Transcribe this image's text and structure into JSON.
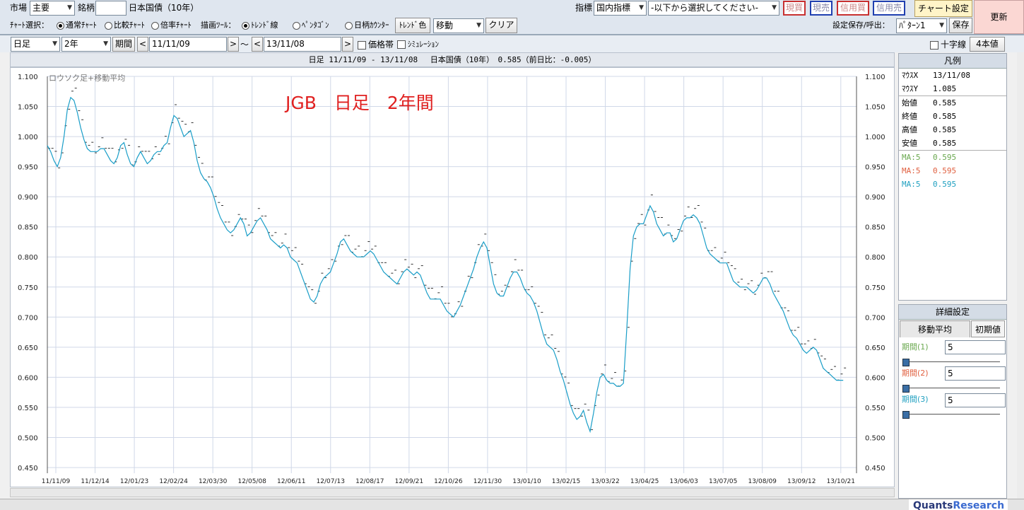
{
  "row1": {
    "market_label": "市場",
    "market_value": "主要",
    "symbol_label": "銘柄",
    "symbol_value": "",
    "symbol_name": "日本国債（10年）",
    "indicator_label": "指標",
    "indicator_value": "国内指標",
    "indicator_select": "-以下から選択してください-",
    "trade_buttons": [
      {
        "label": "現買",
        "color": "#c83030"
      },
      {
        "label": "現売",
        "color": "#2040b0"
      },
      {
        "label": "信用買",
        "color": "#c83030"
      },
      {
        "label": "信用売",
        "color": "#2040b0"
      }
    ],
    "chart_settings": "チャート設定",
    "refresh": "更新"
  },
  "row2": {
    "chart_select_label": "ﾁｬｰﾄ選択：",
    "chart_types": [
      {
        "label": "通常ﾁｬｰﾄ",
        "checked": true
      },
      {
        "label": "比較ﾁｬｰﾄ",
        "checked": false
      },
      {
        "label": "倍率ﾁｬｰﾄ",
        "checked": false
      }
    ],
    "draw_tool_label": "描画ﾂｰﾙ：",
    "draw_tools": [
      {
        "label": "ﾄﾚﾝﾄﾞ線",
        "checked": true
      },
      {
        "label": "ﾍﾟﾝﾀｺﾞﾝ",
        "checked": false
      },
      {
        "label": "日柄ｶｳﾝﾀｰ",
        "checked": false
      }
    ],
    "trend_color": "ﾄﾚﾝﾄﾞ色",
    "move_value": "移動",
    "clear": "クリア",
    "save_load_label": "設定保存/呼出：",
    "pattern_value": "ﾊﾟﾀｰﾝ1",
    "save": "保存"
  },
  "row3": {
    "period_type": "日足",
    "range": "2年",
    "period_button": "期間",
    "prev": "<",
    "next": ">",
    "from_date": "11/11/09",
    "tilde": "〜",
    "prev2": "<",
    "to_date": "13/11/08",
    "next2": ">",
    "price_band": "価格帯",
    "simulation": "ｼﾐｭﾚｰｼｮﾝ",
    "crosshair": "十字線",
    "four_values": "4本値"
  },
  "chart_header": "日足 11/11/09 - 13/11/08　 日本国債（10年）　0.585（前日比：-0.005）",
  "chart_overlay_label": "ロウソク足+移動平均",
  "annotation": "JGB　日足　2年間",
  "legend": {
    "title": "凡例",
    "mouse": [
      {
        "label": "ﾏｳｽX",
        "value": "13/11/08"
      },
      {
        "label": "ﾏｳｽY",
        "value": "1.085"
      }
    ],
    "ohlc": [
      {
        "label": "始値",
        "value": "0.585"
      },
      {
        "label": "終値",
        "value": "0.585"
      },
      {
        "label": "高値",
        "value": "0.585"
      },
      {
        "label": "安値",
        "value": "0.585"
      }
    ],
    "ma": [
      {
        "label": "MA:5",
        "value": "0.595",
        "color": "#6aa84f"
      },
      {
        "label": "MA:5",
        "value": "0.595",
        "color": "#e06040"
      },
      {
        "label": "MA:5",
        "value": "0.595",
        "color": "#20a0c0"
      }
    ]
  },
  "details": {
    "title": "詳細設定",
    "tab_ma": "移動平均",
    "tab_init": "初期値",
    "periods": [
      {
        "label": "期間(1)",
        "value": "5",
        "color": "#6aa84f"
      },
      {
        "label": "期間(2)",
        "value": "5",
        "color": "#e06040"
      },
      {
        "label": "期間(3)",
        "value": "5",
        "color": "#20a0c0"
      }
    ]
  },
  "footer_brand": [
    "Quants",
    "Research"
  ],
  "chart_data": {
    "type": "line",
    "series": [
      {
        "name": "MA:5",
        "color": "#1a9ec8"
      }
    ],
    "ylim": [
      0.45,
      1.1
    ],
    "yticks": [
      "1.100",
      "1.050",
      "1.000",
      "0.950",
      "0.900",
      "0.850",
      "0.800",
      "0.750",
      "0.700",
      "0.650",
      "0.600",
      "0.550",
      "0.500",
      "0.450"
    ],
    "xticks": [
      "11/11/09",
      "11/12/14",
      "12/01/23",
      "12/02/24",
      "12/03/30",
      "12/05/08",
      "12/06/11",
      "12/07/13",
      "12/08/17",
      "12/09/21",
      "12/10/26",
      "12/11/30",
      "13/01/10",
      "13/02/15",
      "13/03/22",
      "13/04/25",
      "13/06/03",
      "13/07/05",
      "13/08/09",
      "13/09/12",
      "13/10/21"
    ],
    "x": [
      0,
      2,
      4,
      6,
      8,
      10,
      12,
      14,
      16,
      18,
      20,
      22,
      24,
      26,
      28,
      30,
      32,
      34,
      36,
      38,
      40,
      42,
      44,
      46,
      48,
      50,
      52,
      54,
      56,
      58,
      60,
      62,
      64,
      66,
      68,
      70,
      72,
      74,
      76,
      78,
      80,
      82,
      84,
      86,
      88,
      90,
      92,
      94,
      96,
      98,
      100,
      102,
      104,
      106,
      108,
      110,
      112,
      114,
      116,
      118,
      120,
      122,
      124,
      126,
      128,
      130,
      132,
      134,
      136,
      138,
      140,
      142,
      144,
      146,
      148,
      150,
      152,
      154,
      156,
      158,
      160,
      162,
      164,
      166,
      168,
      170,
      172,
      174,
      176,
      178,
      180,
      182,
      184,
      186,
      188,
      190,
      192,
      194,
      196,
      198,
      200,
      202,
      204,
      206,
      208,
      210,
      212,
      214,
      216,
      218,
      220,
      222,
      224,
      226,
      228,
      230,
      232,
      234,
      236,
      238,
      240,
      242,
      244,
      246,
      248,
      250,
      252,
      254,
      256,
      258,
      260,
      262,
      264,
      266,
      268,
      270,
      272,
      274,
      276,
      278,
      280,
      282,
      284,
      286,
      288,
      290,
      292,
      294,
      296,
      298,
      300,
      302,
      304,
      306,
      308,
      310,
      312,
      314,
      316,
      318,
      320,
      322,
      324,
      326,
      328,
      330,
      332,
      334,
      336,
      338,
      340,
      342,
      344,
      346,
      348,
      350,
      352,
      354,
      356,
      358,
      360,
      362,
      364,
      366,
      368,
      370,
      372,
      374,
      376,
      378,
      380,
      382,
      384,
      386,
      388,
      390,
      392,
      394,
      396,
      398,
      400,
      402,
      404,
      406,
      408,
      410,
      412,
      414,
      416,
      418,
      420,
      422,
      424,
      426,
      428,
      430,
      432,
      434,
      436,
      438,
      440,
      442,
      444,
      446,
      448,
      450,
      452,
      454,
      456,
      458,
      460,
      462,
      464,
      466,
      468,
      470,
      472,
      474,
      476,
      478,
      480,
      482,
      484,
      486
    ],
    "values": [
      0.985,
      0.975,
      0.96,
      0.95,
      0.965,
      1.0,
      1.045,
      1.065,
      1.06,
      1.04,
      1.015,
      0.995,
      0.98,
      0.975,
      0.975,
      0.975,
      0.98,
      0.98,
      0.97,
      0.96,
      0.955,
      0.965,
      0.985,
      0.99,
      0.97,
      0.955,
      0.95,
      0.965,
      0.975,
      0.965,
      0.955,
      0.96,
      0.97,
      0.975,
      0.975,
      0.985,
      0.99,
      1.015,
      1.035,
      1.03,
      1.015,
      1.0,
      1.005,
      1.01,
      0.99,
      0.96,
      0.94,
      0.93,
      0.925,
      0.915,
      0.9,
      0.88,
      0.865,
      0.855,
      0.845,
      0.84,
      0.845,
      0.855,
      0.865,
      0.855,
      0.835,
      0.84,
      0.85,
      0.86,
      0.865,
      0.855,
      0.845,
      0.83,
      0.825,
      0.82,
      0.815,
      0.82,
      0.815,
      0.8,
      0.795,
      0.79,
      0.775,
      0.76,
      0.745,
      0.73,
      0.725,
      0.735,
      0.755,
      0.765,
      0.77,
      0.775,
      0.79,
      0.805,
      0.825,
      0.83,
      0.82,
      0.81,
      0.805,
      0.8,
      0.8,
      0.8,
      0.805,
      0.81,
      0.805,
      0.795,
      0.785,
      0.775,
      0.77,
      0.765,
      0.76,
      0.755,
      0.765,
      0.775,
      0.78,
      0.775,
      0.77,
      0.775,
      0.77,
      0.755,
      0.74,
      0.73,
      0.73,
      0.73,
      0.73,
      0.72,
      0.71,
      0.705,
      0.7,
      0.71,
      0.72,
      0.735,
      0.75,
      0.765,
      0.78,
      0.8,
      0.815,
      0.825,
      0.815,
      0.785,
      0.755,
      0.74,
      0.735,
      0.735,
      0.75,
      0.765,
      0.775,
      0.775,
      0.765,
      0.75,
      0.74,
      0.735,
      0.725,
      0.71,
      0.69,
      0.67,
      0.655,
      0.65,
      0.645,
      0.63,
      0.61,
      0.595,
      0.575,
      0.555,
      0.54,
      0.53,
      0.535,
      0.545,
      0.525,
      0.51,
      0.54,
      0.575,
      0.6,
      0.605,
      0.595,
      0.59,
      0.59,
      0.585,
      0.585,
      0.59,
      0.68,
      0.78,
      0.835,
      0.85,
      0.855,
      0.855,
      0.87,
      0.885,
      0.875,
      0.855,
      0.845,
      0.835,
      0.84,
      0.84,
      0.825,
      0.83,
      0.845,
      0.86,
      0.865,
      0.865,
      0.87,
      0.865,
      0.855,
      0.835,
      0.815,
      0.805,
      0.8,
      0.795,
      0.79,
      0.79,
      0.79,
      0.775,
      0.76,
      0.755,
      0.75,
      0.75,
      0.75,
      0.745,
      0.74,
      0.745,
      0.755,
      0.765,
      0.765,
      0.755,
      0.74,
      0.73,
      0.72,
      0.71,
      0.695,
      0.68,
      0.67,
      0.665,
      0.655,
      0.645,
      0.64,
      0.645,
      0.65,
      0.645,
      0.63,
      0.615,
      0.61,
      0.605,
      0.6,
      0.595,
      0.595,
      0.595
    ]
  }
}
